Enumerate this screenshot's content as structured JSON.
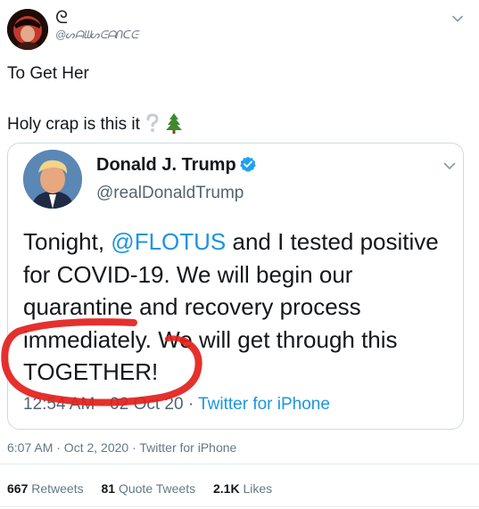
{
  "author": {
    "name_fancy": "ᘓ",
    "handle_fancy": "@ᔕᗩᗯᔕᕮᗩᑎᑕᕮ"
  },
  "tweet": {
    "line1": "To Get Her",
    "line2": "Holy crap is this it",
    "emoji_question": "question-icon",
    "emoji_tree": "tree-icon"
  },
  "quoted": {
    "name": "Donald J. Trump",
    "handle": "@realDonaldTrump",
    "body_part1": "Tonight, ",
    "mention": "@FLOTUS",
    "body_part2": " and I tested positive for COVID-19. We will begin our quarantine and recovery process immediately. We will get through this TOGETHER!",
    "time": "12:54 AM · 02 Oct 20",
    "sep": " · ",
    "source": "Twitter for iPhone"
  },
  "meta": {
    "timestamp": "6:07 AM · Oct 2, 2020 · Twitter for iPhone"
  },
  "stats": {
    "retweets_count": "667",
    "retweets_label": "Retweets",
    "quotes_count": "81",
    "quotes_label": "Quote Tweets",
    "likes_count": "2.1K",
    "likes_label": "Likes"
  },
  "colors": {
    "link": "#1b95e0",
    "verified": "#1da1f2",
    "scribble": "#e3201b"
  }
}
